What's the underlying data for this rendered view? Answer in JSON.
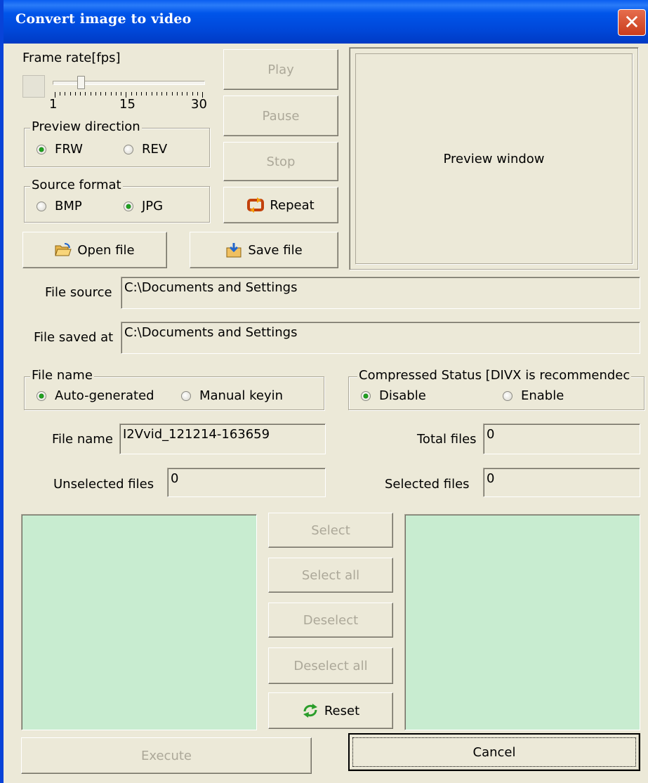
{
  "window": {
    "title": "Convert image to video",
    "close_glyph": "✕"
  },
  "framerate": {
    "label": "Frame rate[fps]",
    "value": 6,
    "min": 1,
    "max": 30,
    "tick_labels": [
      "1",
      "15",
      "30"
    ]
  },
  "preview_direction": {
    "label": "Preview direction",
    "options": [
      {
        "label": "FRW",
        "selected": true
      },
      {
        "label": "REV",
        "selected": false
      }
    ]
  },
  "source_format": {
    "label": "Source format",
    "options": [
      {
        "label": "BMP",
        "selected": false
      },
      {
        "label": "JPG",
        "selected": true
      }
    ]
  },
  "playback": {
    "play": "Play",
    "pause": "Pause",
    "stop": "Stop",
    "repeat": "Repeat",
    "repeat_icon": "repeat-icon"
  },
  "preview": {
    "label": "Preview window"
  },
  "file_buttons": {
    "open": "Open file",
    "open_icon": "open-folder-icon",
    "save": "Save file",
    "save_icon": "save-file-icon"
  },
  "file_source": {
    "label": "File source",
    "value": "C:\\Documents and Settings"
  },
  "file_saved_at": {
    "label": "File saved at",
    "value": "C:\\Documents and Settings"
  },
  "file_name_mode": {
    "label": "File name",
    "options": [
      {
        "label": "Auto-generated",
        "selected": true
      },
      {
        "label": "Manual keyin",
        "selected": false
      }
    ]
  },
  "compressed": {
    "label": "Compressed Status [DIVX is recommendec",
    "options": [
      {
        "label": "Disable",
        "selected": true
      },
      {
        "label": "Enable",
        "selected": false
      }
    ]
  },
  "file_name": {
    "label": "File name",
    "value": "I2Vvid_121214-163659"
  },
  "total_files": {
    "label": "Total files",
    "value": "0"
  },
  "unselected_files": {
    "label": "Unselected files",
    "value": "0"
  },
  "selected_files": {
    "label": "Selected files",
    "value": "0"
  },
  "selection_buttons": {
    "select": "Select",
    "select_all": "Select all",
    "deselect": "Deselect",
    "deselect_all": "Deselect all",
    "reset": "Reset",
    "reset_icon": "reset-arrows-icon"
  },
  "actions": {
    "execute": "Execute",
    "cancel": "Cancel"
  },
  "colors": {
    "titlebar": "#0054e3",
    "listbox_bg": "#c8ecd0",
    "dialog_bg": "#ece9d8"
  }
}
